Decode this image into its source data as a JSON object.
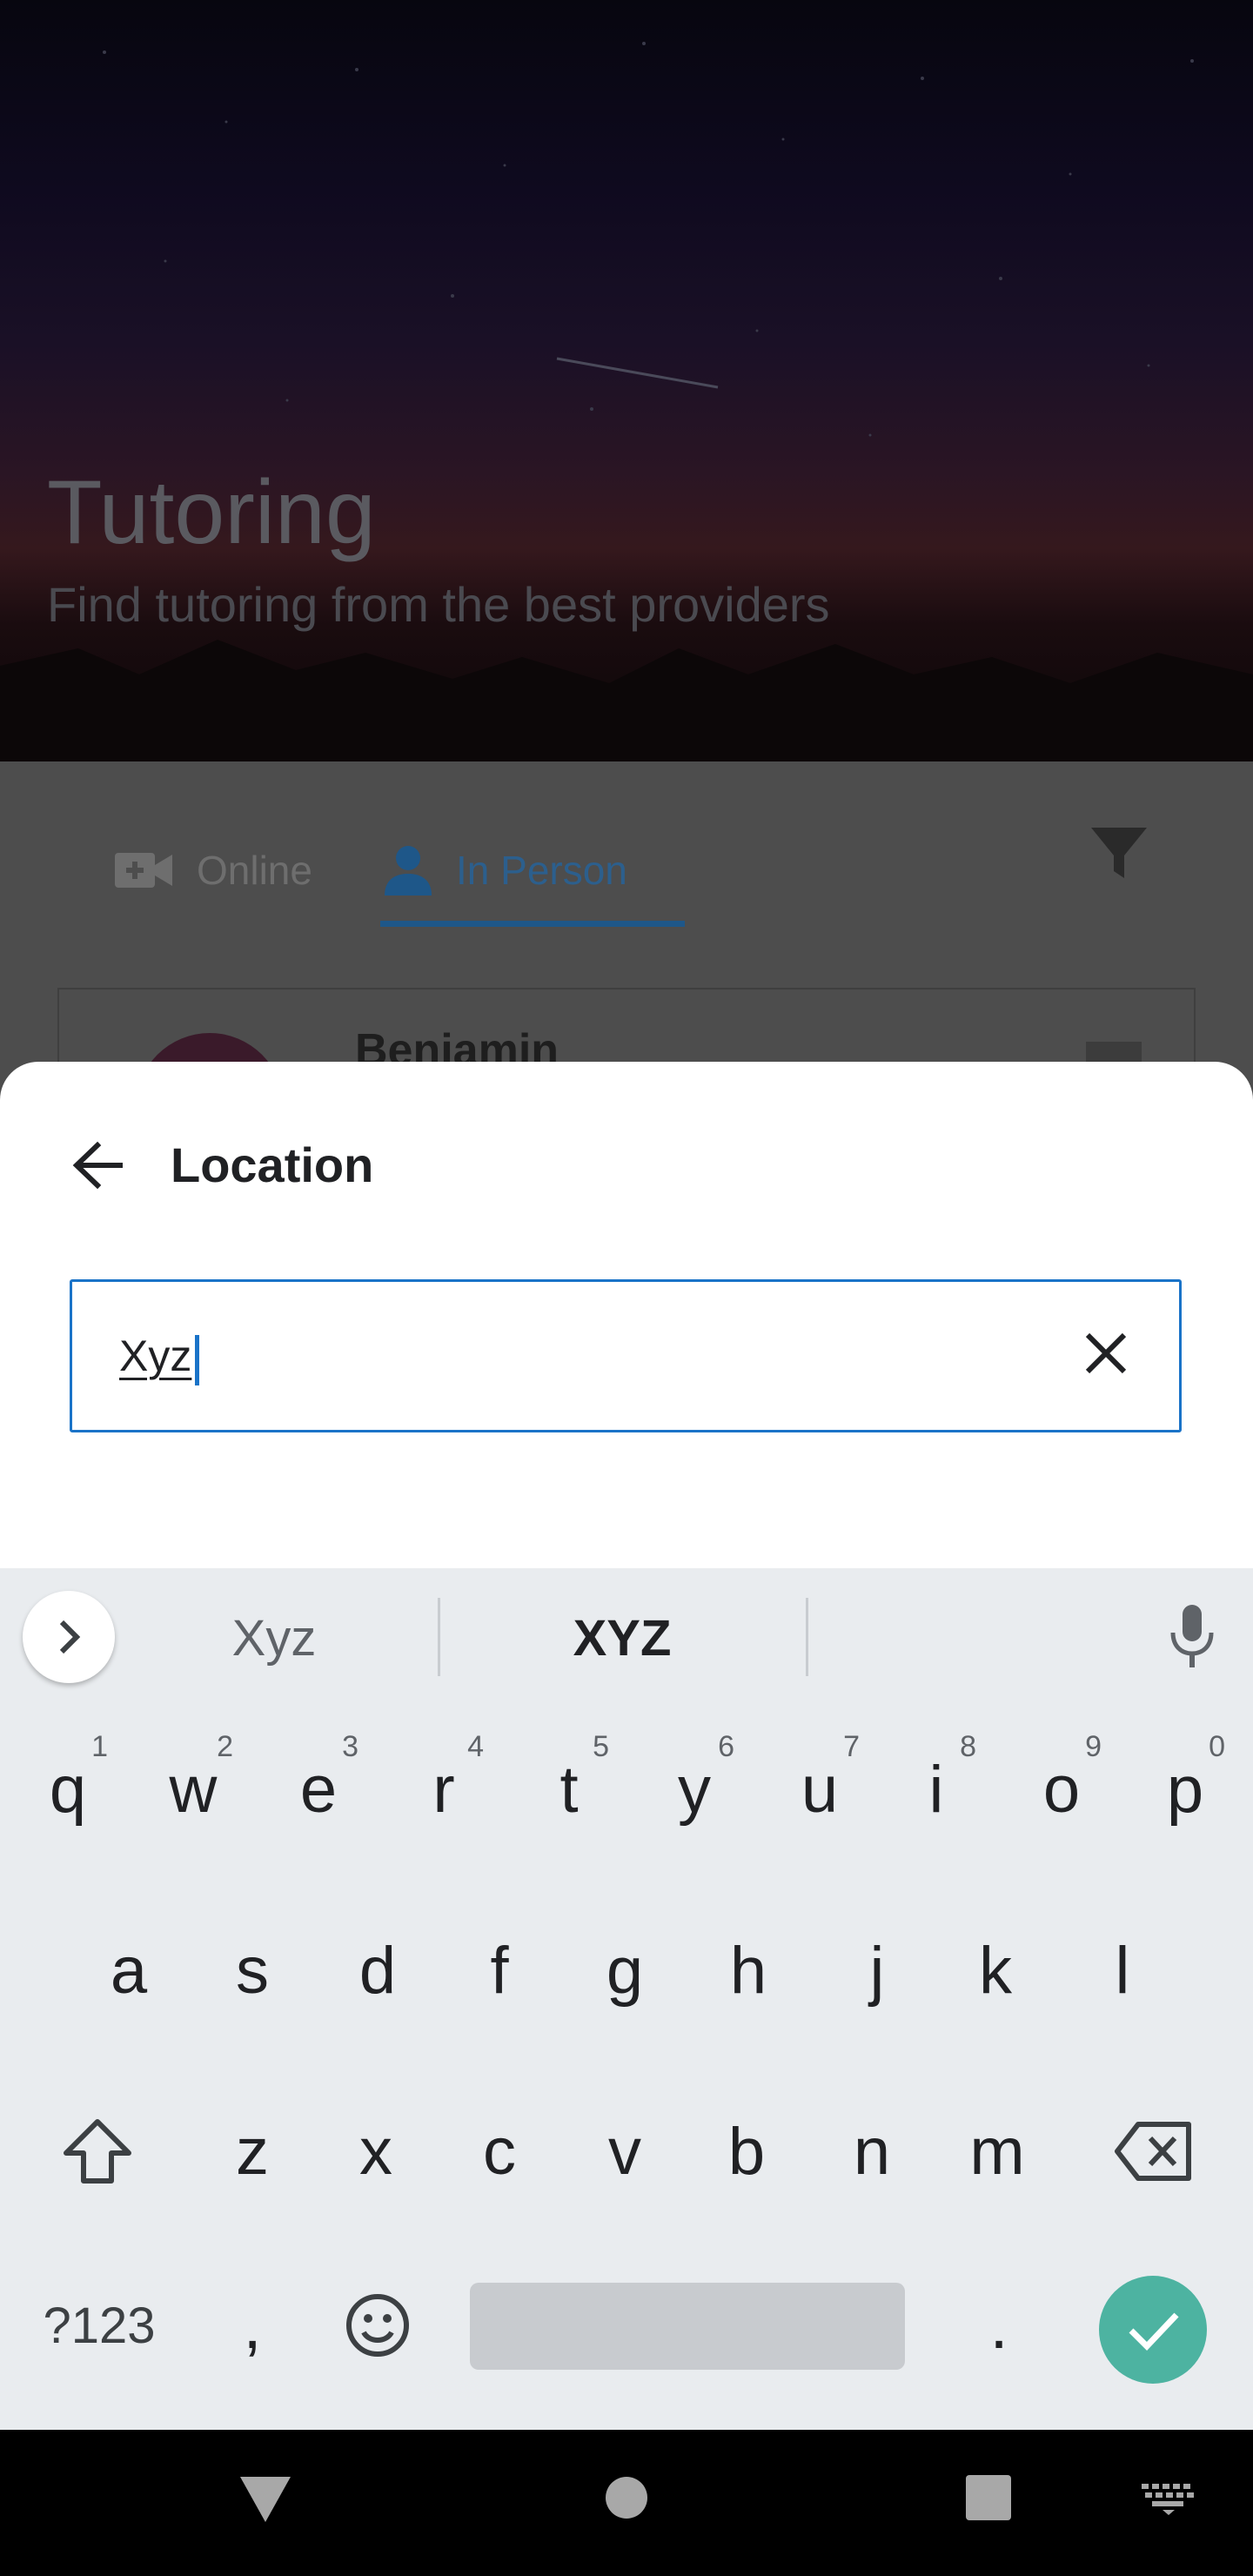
{
  "background": {
    "hero": {
      "title": "Tutoring",
      "subtitle": "Find tutoring from the best providers"
    },
    "tabs": [
      {
        "label": "Online",
        "icon": "video-icon",
        "selected": false
      },
      {
        "label": "In Person",
        "icon": "person-icon",
        "selected": true
      }
    ],
    "filter_icon": "filter-icon",
    "card": {
      "name": "Benjamin"
    }
  },
  "sheet": {
    "title": "Location",
    "back_icon": "arrow-left-icon",
    "search": {
      "value": "Xyz",
      "placeholder": ""
    },
    "clear_icon": "close-icon"
  },
  "keyboard": {
    "suggestions": [
      "Xyz",
      "XYZ"
    ],
    "row1": [
      {
        "key": "q",
        "hint": "1"
      },
      {
        "key": "w",
        "hint": "2"
      },
      {
        "key": "e",
        "hint": "3"
      },
      {
        "key": "r",
        "hint": "4"
      },
      {
        "key": "t",
        "hint": "5"
      },
      {
        "key": "y",
        "hint": "6"
      },
      {
        "key": "u",
        "hint": "7"
      },
      {
        "key": "i",
        "hint": "8"
      },
      {
        "key": "o",
        "hint": "9"
      },
      {
        "key": "p",
        "hint": "0"
      }
    ],
    "row2": [
      "a",
      "s",
      "d",
      "f",
      "g",
      "h",
      "j",
      "k",
      "l"
    ],
    "row3": [
      "z",
      "x",
      "c",
      "v",
      "b",
      "n",
      "m"
    ],
    "symbols_label": "?123",
    "comma": ",",
    "period": "."
  },
  "colors": {
    "accent": "#1a73c8",
    "enter_key": "#4db3a1",
    "selected_tab": "#1e5789"
  }
}
